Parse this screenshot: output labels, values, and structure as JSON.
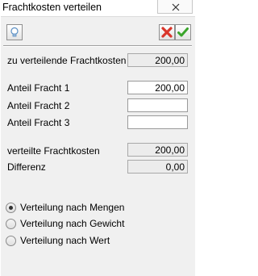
{
  "window": {
    "title": "Frachtkosten verteilen",
    "close_symbol": "X"
  },
  "toolbar": {
    "help_icon": "lightbulb-icon",
    "cancel_icon": "red-x-icon",
    "ok_icon": "green-check-icon",
    "colors": {
      "cancel": "#d9362b",
      "ok": "#3aa52b"
    }
  },
  "form": {
    "total_label": "zu verteilende Frachtkosten",
    "total_value": "200,00",
    "share1_label": "Anteil Fracht 1",
    "share1_value": "200,00",
    "share2_label": "Anteil Fracht 2",
    "share2_value": "",
    "share3_label": "Anteil Fracht 3",
    "share3_value": "",
    "distributed_label": "verteilte Frachtkosten",
    "distributed_value": "200,00",
    "difference_label": "Differenz",
    "difference_value": "0,00"
  },
  "distribution": {
    "options": [
      {
        "label": "Verteilung nach Mengen",
        "selected": true
      },
      {
        "label": "Verteilung nach Gewicht",
        "selected": false
      },
      {
        "label": "Verteilung nach Wert",
        "selected": false
      }
    ]
  }
}
